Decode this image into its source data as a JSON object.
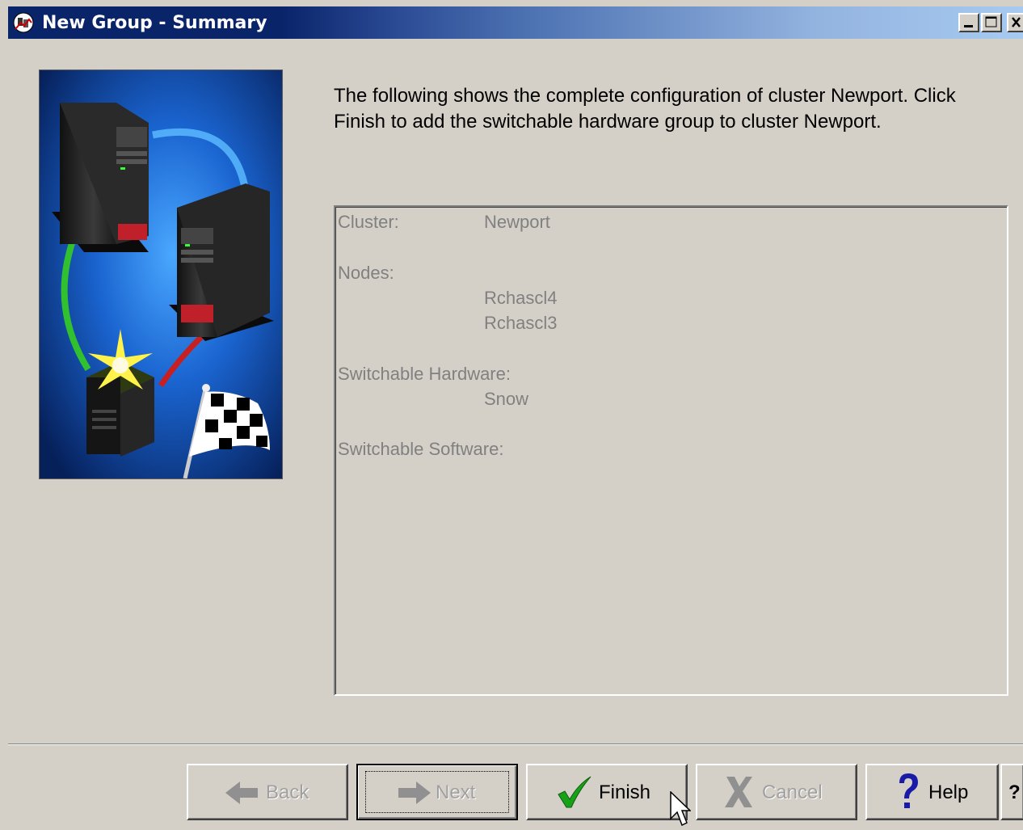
{
  "window": {
    "title": "New Group - Summary"
  },
  "intro_text": "The following shows the complete configuration of cluster Newport.  Click Finish to add the switchable hardware group to cluster Newport.",
  "summary": {
    "cluster_label": "Cluster:",
    "cluster_value": "Newport",
    "nodes_label": "Nodes:",
    "nodes": [
      "Rchascl4",
      "Rchascl3"
    ],
    "hardware_label": "Switchable Hardware:",
    "hardware": [
      "Snow"
    ],
    "software_label": "Switchable Software:"
  },
  "buttons": {
    "back": "Back",
    "next": "Next",
    "finish": "Finish",
    "cancel": "Cancel",
    "help": "Help",
    "whats_this": "?"
  },
  "icons": {
    "title": "wizard-app-icon",
    "back": "arrow-left-icon",
    "next": "arrow-right-icon",
    "finish": "checkmark-icon",
    "cancel": "x-icon",
    "help": "question-mark-icon"
  }
}
